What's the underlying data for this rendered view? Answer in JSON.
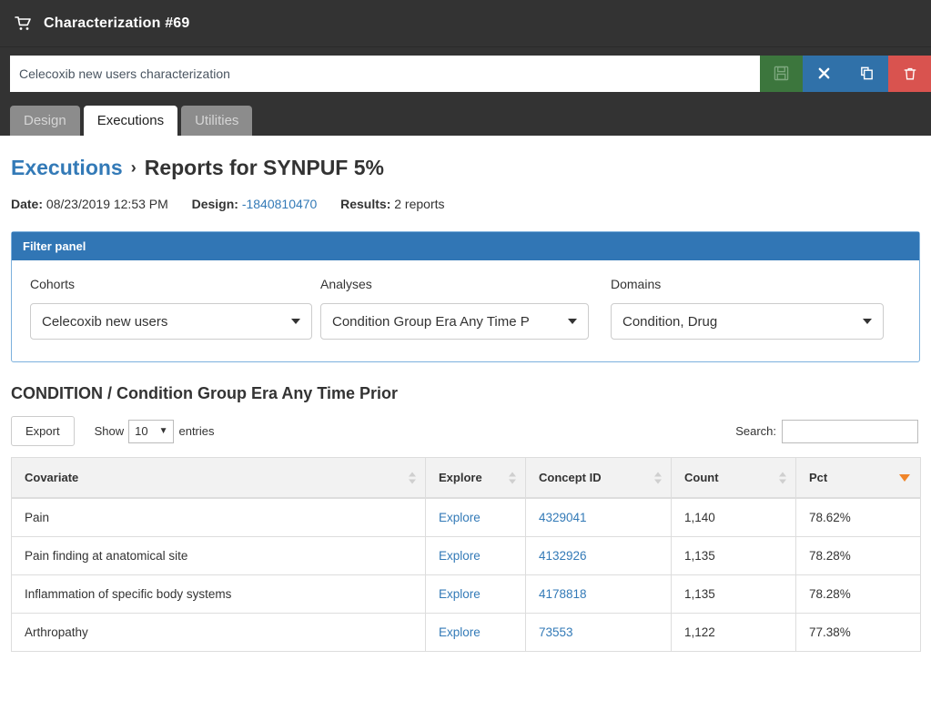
{
  "titlebar": {
    "icon": "shopping-cart-icon",
    "title": "Characterization #69"
  },
  "name_row": {
    "value": "Celecoxib new users characterization",
    "placeholder": "Characterization name",
    "buttons": [
      {
        "name": "save-button",
        "icon": "floppy-disk-icon",
        "glyph": "💾",
        "color": "#3c763d"
      },
      {
        "name": "close-button",
        "icon": "close-x-icon",
        "glyph": "✖",
        "color": "#3071a9"
      },
      {
        "name": "copy-button",
        "icon": "copy-icon",
        "glyph": "⧉",
        "color": "#3071a9"
      },
      {
        "name": "delete-button",
        "icon": "trash-icon",
        "glyph": "🗑",
        "color": "#d9534f"
      }
    ]
  },
  "tabs": [
    {
      "label": "Design",
      "active": false
    },
    {
      "label": "Executions",
      "active": true
    },
    {
      "label": "Utilities",
      "active": false
    }
  ],
  "breadcrumb": {
    "link": "Executions",
    "separator": "›",
    "current": "Reports for SYNPUF 5%"
  },
  "meta": {
    "date_label": "Date:",
    "date_value": "08/23/2019 12:53 PM",
    "design_label": "Design:",
    "design_value": "-1840810470",
    "results_label": "Results:",
    "results_value": "2 reports"
  },
  "filter_panel": {
    "heading": "Filter panel",
    "filters": [
      {
        "label": "Cohorts",
        "value": "Celecoxib new users"
      },
      {
        "label": "Analyses",
        "value": "Condition Group Era Any Time P"
      },
      {
        "label": "Domains",
        "value": "Condition, Drug"
      }
    ]
  },
  "report": {
    "section_title": "CONDITION / Condition Group Era Any Time Prior",
    "export_label": "Export",
    "show_label": "Show",
    "entries_value": "10",
    "entries_label": "entries",
    "search_label": "Search:",
    "search_value": "",
    "search_placeholder": ""
  },
  "table": {
    "columns": [
      {
        "label": "Covariate",
        "sort": "none"
      },
      {
        "label": "Explore",
        "sort": "none"
      },
      {
        "label": "Concept ID",
        "sort": "none"
      },
      {
        "label": "Count",
        "sort": "none"
      },
      {
        "label": "Pct",
        "sort": "desc"
      }
    ],
    "rows": [
      {
        "covariate": "Pain",
        "explore": "Explore",
        "concept_id": "4329041",
        "count": "1,140",
        "pct": "78.62%"
      },
      {
        "covariate": "Pain finding at anatomical site",
        "explore": "Explore",
        "concept_id": "4132926",
        "count": "1,135",
        "pct": "78.28%"
      },
      {
        "covariate": "Inflammation of specific body systems",
        "explore": "Explore",
        "concept_id": "4178818",
        "count": "1,135",
        "pct": "78.28%"
      },
      {
        "covariate": "Arthropathy",
        "explore": "Explore",
        "concept_id": "73553",
        "count": "1,122",
        "pct": "77.38%"
      }
    ]
  },
  "colors": {
    "chrome_dark": "#333333",
    "tab_inactive": "#8c8c8c",
    "panel_blue": "#3176b5",
    "link_blue": "#337ab7",
    "sort_orange": "#f0852a",
    "danger_red": "#d9534f",
    "success_green": "#3c763d"
  }
}
